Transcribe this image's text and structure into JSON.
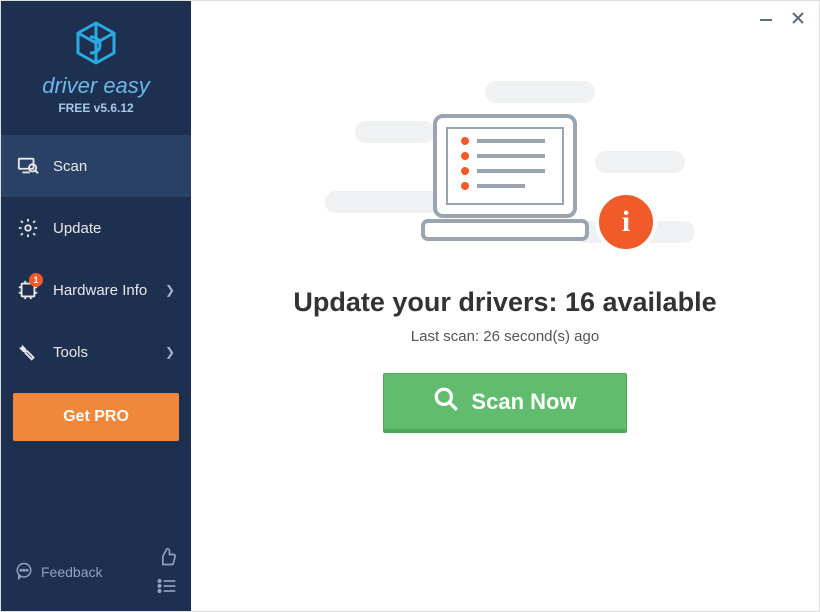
{
  "brand": "driver easy",
  "version": "FREE v5.6.12",
  "sidebar": {
    "items": [
      {
        "label": "Scan"
      },
      {
        "label": "Update"
      },
      {
        "label": "Hardware Info"
      },
      {
        "label": "Tools"
      }
    ],
    "hardware_badge": "1",
    "getpro_label": "Get PRO",
    "feedback_label": "Feedback"
  },
  "main": {
    "headline": "Update your drivers: 16 available",
    "subline": "Last scan: 26 second(s) ago",
    "scan_button": "Scan Now"
  },
  "colors": {
    "sidebar_bg": "#1e3050",
    "accent_orange": "#f0873a",
    "alert_orange": "#f15a29",
    "scan_green": "#61bd6d",
    "brand_blue": "#29abe2"
  }
}
